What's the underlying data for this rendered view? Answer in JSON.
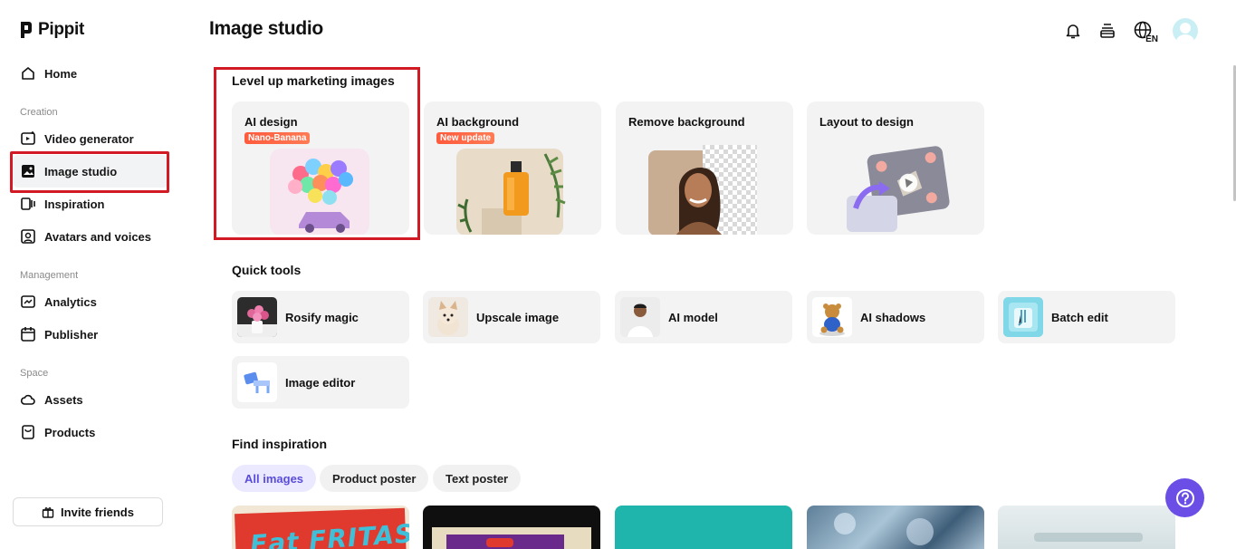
{
  "app": {
    "name": "Pippit"
  },
  "page": {
    "title": "Image studio"
  },
  "sidebar": {
    "home": "Home",
    "sections": {
      "creation": "Creation",
      "management": "Management",
      "space": "Space"
    },
    "items": {
      "video_generator": "Video generator",
      "image_studio": "Image studio",
      "inspiration": "Inspiration",
      "avatars": "Avatars and voices",
      "analytics": "Analytics",
      "publisher": "Publisher",
      "assets": "Assets",
      "products": "Products"
    },
    "invite": "Invite friends"
  },
  "header": {
    "language": "EN"
  },
  "marketing": {
    "heading": "Level up marketing images",
    "cards": [
      {
        "title": "AI design",
        "badge": "Nano-Banana"
      },
      {
        "title": "AI background",
        "badge": "New update"
      },
      {
        "title": "Remove background"
      },
      {
        "title": "Layout to design"
      }
    ]
  },
  "quick_tools": {
    "heading": "Quick tools",
    "items": [
      "Rosify magic",
      "Upscale image",
      "AI model",
      "AI shadows",
      "Batch edit",
      "Image editor"
    ]
  },
  "inspiration": {
    "heading": "Find inspiration",
    "filters": [
      "All images",
      "Product poster",
      "Text poster"
    ],
    "active_filter": "All images",
    "tile_text": "Eat FRITAS!"
  },
  "colors": {
    "accent": "#5a4cdb",
    "highlight": "#d11a24",
    "badge": "#ff5a3c",
    "help": "#6b4ee6"
  }
}
